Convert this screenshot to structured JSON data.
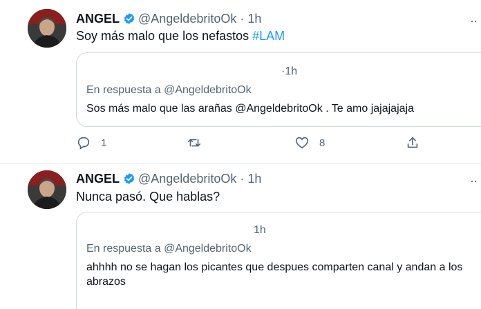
{
  "tweets": [
    {
      "author_name": "ANGEL",
      "handle": "@AngeldebritoOk",
      "dot": "·",
      "time": "1h",
      "text_prefix": "Soy más malo que los nefastos ",
      "hashtag": "#LAM",
      "quote": {
        "time": "1h",
        "replying_to": "En respuesta a @AngeldebritoOk",
        "text": "Sos más malo que las arañas @AngeldebritoOk . Te amo jajajajaja"
      },
      "actions": {
        "reply_count": "1",
        "retweet_count": "",
        "like_count": "8",
        "icons": [
          "reply-icon",
          "retweet-icon",
          "like-icon",
          "share-icon"
        ]
      }
    },
    {
      "author_name": "ANGEL",
      "handle": "@AngeldebritoOk",
      "dot": "·",
      "time": "1h",
      "text": "Nunca pasó. Que hablas?",
      "quote": {
        "time": "1h",
        "replying_to": "En respuesta a @AngeldebritoOk",
        "text": "ahhhh no se hagan los picantes que despues comparten canal y andan a los abrazos"
      }
    }
  ],
  "more_icon": "more-icon",
  "colors": {
    "accent": "#1d9bf0",
    "secondary_text": "#536471",
    "border": "#cfd9de",
    "verified": "#1d9bf0"
  }
}
